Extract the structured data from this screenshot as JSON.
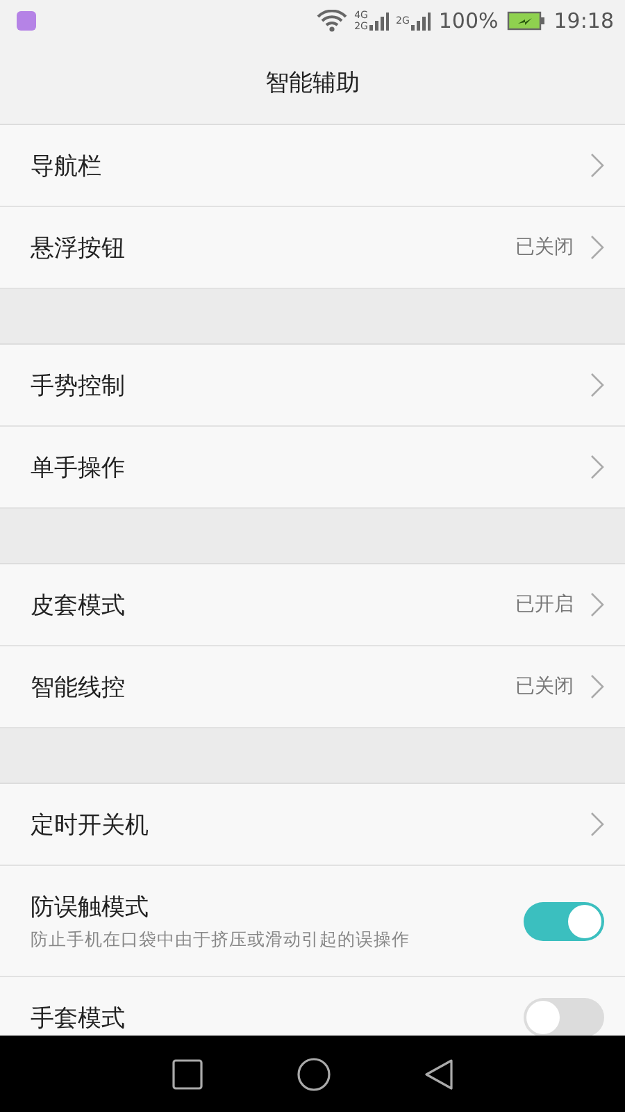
{
  "status_bar": {
    "sim1_top": "4G",
    "sim1_bottom": "2G",
    "sim2": "2G",
    "battery_percent": "100%",
    "time": "19:18"
  },
  "title": "智能辅助",
  "sections": [
    {
      "items": [
        {
          "kind": "link",
          "label": "导航栏"
        },
        {
          "kind": "link",
          "label": "悬浮按钮",
          "value": "已关闭"
        }
      ]
    },
    {
      "items": [
        {
          "kind": "link",
          "label": "手势控制"
        },
        {
          "kind": "link",
          "label": "单手操作"
        }
      ]
    },
    {
      "items": [
        {
          "kind": "link",
          "label": "皮套模式",
          "value": "已开启"
        },
        {
          "kind": "link",
          "label": "智能线控",
          "value": "已关闭"
        }
      ]
    },
    {
      "items": [
        {
          "kind": "link",
          "label": "定时开关机"
        },
        {
          "kind": "toggle",
          "label": "防误触模式",
          "description": "防止手机在口袋中由于挤压或滑动引起的误操作",
          "on": true
        },
        {
          "kind": "toggle",
          "label": "手套模式",
          "on": false
        }
      ]
    }
  ]
}
